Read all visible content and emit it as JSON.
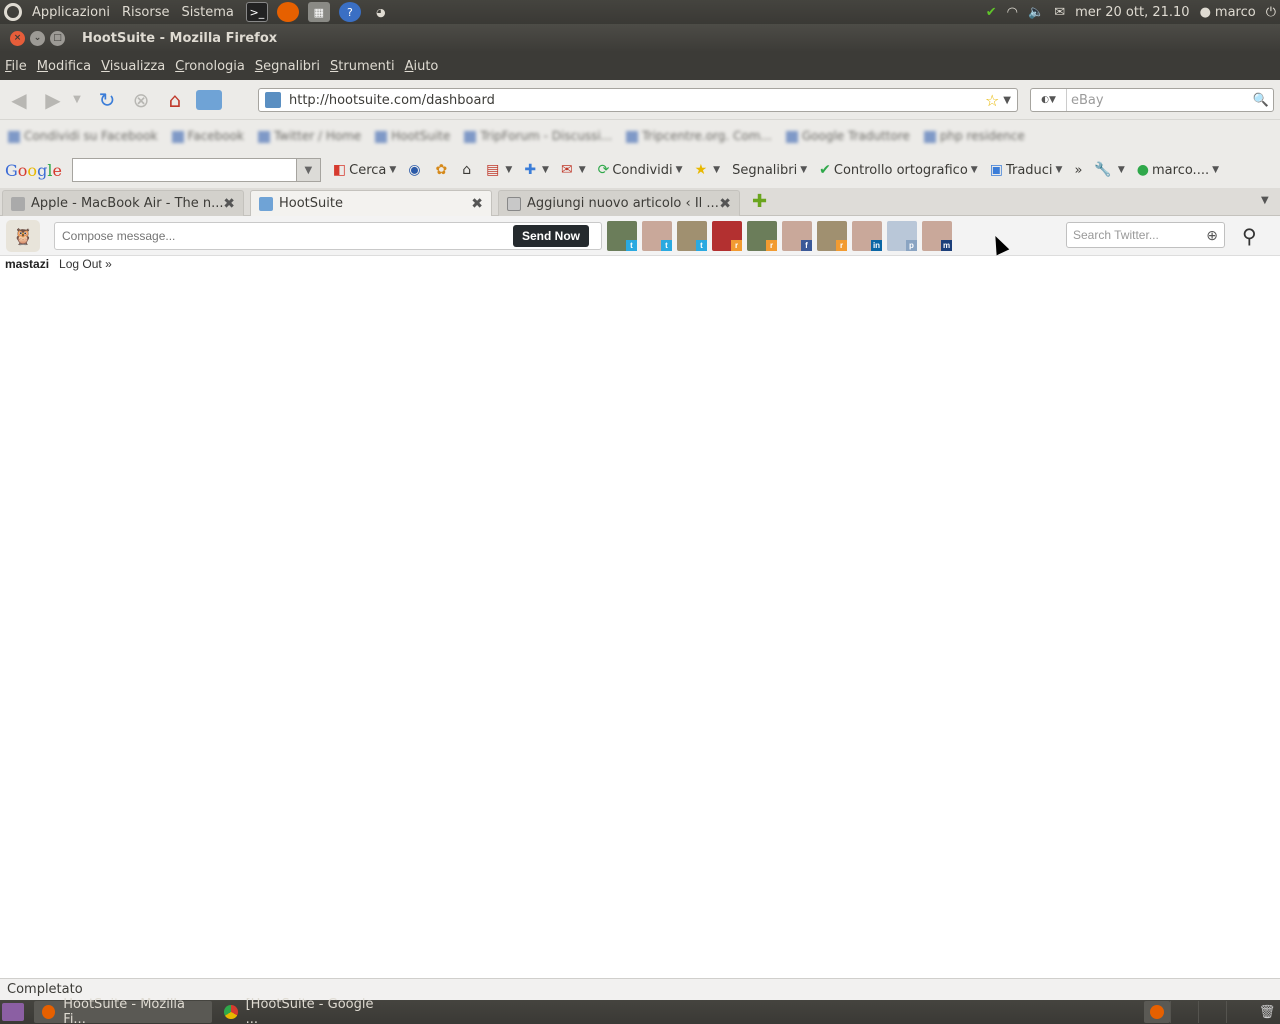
{
  "panel": {
    "menus": [
      "Applicazioni",
      "Risorse",
      "Sistema"
    ],
    "datetime": "mer 20 ott, 21.10",
    "user": "marco"
  },
  "window": {
    "title": "HootSuite - Mozilla Firefox"
  },
  "menubar": [
    "File",
    "Modifica",
    "Visualizza",
    "Cronologia",
    "Segnalibri",
    "Strumenti",
    "Aiuto"
  ],
  "navbar": {
    "url": "http://hootsuite.com/dashboard",
    "search_placeholder": "eBay"
  },
  "bookmarks": [
    "Condividi su Facebook",
    "Facebook",
    "Twitter / Home",
    "HootSuite",
    "TripForum - Discussi...",
    "Tripcentre.org. Com...",
    "Google Traduttore",
    "php residence"
  ],
  "google_toolbar": {
    "cerca": "Cerca",
    "condividi": "Condividi",
    "segnalibri": "Segnalibri",
    "spellcheck": "Controllo ortografico",
    "traduci": "Traduci",
    "more": "»",
    "account": "marco...."
  },
  "tabs": [
    {
      "label": "Apple - MacBook Air - The n...",
      "active": false
    },
    {
      "label": "HootSuite",
      "active": true
    },
    {
      "label": "Aggiungi nuovo articolo ‹ Il ...",
      "active": false
    }
  ],
  "hootsuite": {
    "compose_placeholder": "Compose message...",
    "send_now": "Send Now",
    "search_placeholder": "Search Twitter...",
    "username": "mastazi",
    "logout": "Log Out »",
    "profiles": [
      {
        "network": "twitter",
        "badge": "t",
        "badge_color": "#2aa9e0",
        "avatar_color": "#6b7d5a"
      },
      {
        "network": "twitter",
        "badge": "t",
        "badge_color": "#2aa9e0",
        "avatar_color": "#c9a89a"
      },
      {
        "network": "twitter",
        "badge": "t",
        "badge_color": "#2aa9e0",
        "avatar_color": "#a09070"
      },
      {
        "network": "rss",
        "badge": "r",
        "badge_color": "#f29b31",
        "avatar_color": "#b33030"
      },
      {
        "network": "rss",
        "badge": "r",
        "badge_color": "#f29b31",
        "avatar_color": "#6b7d5a"
      },
      {
        "network": "facebook",
        "badge": "f",
        "badge_color": "#3b5998",
        "avatar_color": "#c9a89a"
      },
      {
        "network": "rss",
        "badge": "r",
        "badge_color": "#f29b31",
        "avatar_color": "#a09070"
      },
      {
        "network": "linkedin",
        "badge": "in",
        "badge_color": "#0a66a5",
        "avatar_color": "#c9a89a"
      },
      {
        "network": "ping",
        "badge": "p",
        "badge_color": "#8aa4c2",
        "avatar_color": "#b9c7d8"
      },
      {
        "network": "myspace",
        "badge": "m",
        "badge_color": "#1c3f7a",
        "avatar_color": "#c9a89a"
      }
    ]
  },
  "status": {
    "text": "Completato"
  },
  "taskbar": [
    {
      "label": "HootSuite - Mozilla Fi...",
      "active": true
    },
    {
      "label": "[HootSuite - Google ...",
      "active": false
    }
  ]
}
